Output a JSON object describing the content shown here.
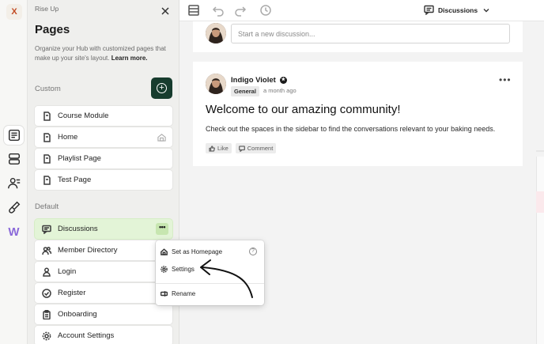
{
  "rail": {
    "logo_letter": "X",
    "icons": [
      "pages-icon",
      "layout-icon",
      "users-icon",
      "brush-icon",
      "w-logo"
    ],
    "w_letter": "W"
  },
  "panel": {
    "overline": "Rise Up",
    "title": "Pages",
    "description": "Organize your Hub with customized pages that make up your site's layout.",
    "learn_more": "Learn more.",
    "custom_label": "Custom",
    "default_label": "Default",
    "custom_items": [
      {
        "label": "Course Module",
        "icon": "page-icon"
      },
      {
        "label": "Home",
        "icon": "page-icon"
      },
      {
        "label": "Playlist Page",
        "icon": "page-icon"
      },
      {
        "label": "Test Page",
        "icon": "page-icon"
      }
    ],
    "default_items": [
      {
        "label": "Discussions",
        "icon": "chat-icon"
      },
      {
        "label": "Member Directory",
        "icon": "people-icon"
      },
      {
        "label": "Login",
        "icon": "person-icon"
      },
      {
        "label": "Register",
        "icon": "check-circle-icon"
      },
      {
        "label": "Onboarding",
        "icon": "clipboard-icon"
      },
      {
        "label": "Account Settings",
        "icon": "gear-icon"
      }
    ],
    "more_label": "•••"
  },
  "topbar": {
    "page_selector": "Discussions"
  },
  "new_discussion": {
    "placeholder": "Start a new discussion..."
  },
  "post": {
    "author": "Indigo Violet",
    "tag": "General",
    "time": "a month ago",
    "more": "•••",
    "title": "Welcome to our amazing community!",
    "body": "Check out the spaces in the sidebar to find the conversations relevant to your baking needs.",
    "like_label": "Like",
    "comment_label": "Comment"
  },
  "context_menu": {
    "items": [
      "Set as Homepage",
      "Settings",
      "Rename"
    ],
    "help": "?"
  },
  "colors": {
    "accent_dark": "#173c2e",
    "selected_bg": "#e3f4d7"
  }
}
